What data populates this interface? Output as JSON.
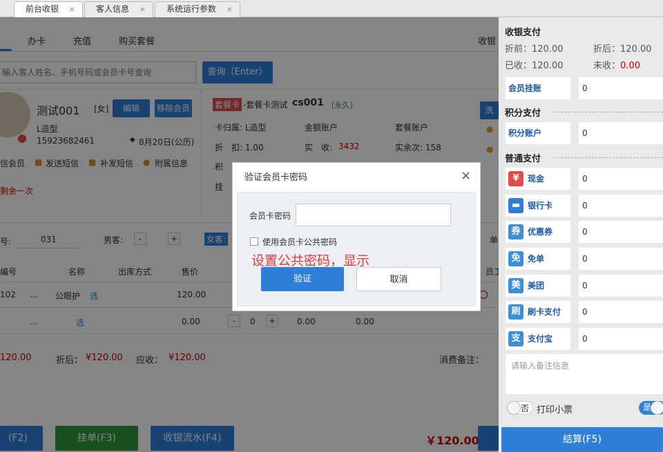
{
  "tabs": [
    {
      "label": "前台收银"
    },
    {
      "label": "客人信息"
    },
    {
      "label": "系统运行参数"
    }
  ],
  "close_glyph": "×",
  "main": {
    "top_nav": [
      "办卡",
      "充值",
      "购买套餐"
    ],
    "cashier_cut": "收银",
    "search": {
      "placeholder": "输入客人姓名、手机号码或会员卡号查询",
      "button": "查询（Enter）"
    },
    "member": {
      "name": "测试001",
      "gender": "[女]",
      "edit": "编辑",
      "remove": "移除会员",
      "type": "L造型",
      "phone": "15923682461",
      "birthday": "8月20日(公历)"
    },
    "member_actions": [
      "信会员",
      "发送短信",
      "补发短信",
      "附属信息"
    ],
    "remaining": "剩余一次",
    "card": {
      "badge": "套餐卡",
      "title": "-套餐卡测试",
      "code": "cs001",
      "permanent": "[永久]",
      "belong": "卡归属: L造型",
      "amount_acct": "金额账户",
      "package_acct": "套餐账户",
      "discount": "折　扣: 1.00",
      "received_label": "实　收:",
      "received": "3432",
      "remaining_count": "实余次: 158",
      "ji": "积",
      "gua": "挂",
      "wash": "洗"
    },
    "order": {
      "no_label": "号:",
      "no": "031",
      "male": "男客:",
      "female": "女客:",
      "minus": "-",
      "plus": "+",
      "dan": "单"
    },
    "table": {
      "headers": [
        "编号",
        "名称",
        "出库方式",
        "售价",
        "员工"
      ],
      "rows": [
        {
          "code": "102",
          "dots": "…",
          "name": "公眼护",
          "select": "选",
          "price": "120.00",
          "qty": ""
        },
        {
          "code": "",
          "dots": "…",
          "name": "",
          "select": "选",
          "price": "0.00",
          "qty": "0",
          "amount": "0.00",
          "amount2": "0.00"
        }
      ]
    },
    "totals": {
      "left": "120.00",
      "after_label": "折后：",
      "after": "¥120.00",
      "due_label": "应收：",
      "due": "¥120.00",
      "remark_label": "消费备注："
    },
    "bottom": {
      "b1": "(F2)",
      "b2": "挂单(F3)",
      "b3": "收银流水(F4)",
      "total": "￥120.00"
    }
  },
  "right": {
    "title": "收银支付",
    "before_label": "折前：",
    "before": "120.00",
    "after_label": "折后：",
    "after": "120.00",
    "received_label": "已收：",
    "received": "120.00",
    "unreceived_label": "未收：",
    "unreceived": "0.00",
    "member_credit": {
      "label": "会员挂账",
      "value": "0"
    },
    "points_section": "积分支付",
    "points": {
      "label": "积分账户",
      "value": "0"
    },
    "normal_section": "普通支付",
    "methods": [
      {
        "name": "现金",
        "icon": "¥",
        "color": "#e34b4b",
        "value": "0",
        "icon_name": "cash-icon"
      },
      {
        "name": "银行卡",
        "icon": "▬",
        "color": "#2f7fd8",
        "value": "0",
        "icon_name": "bank-card-icon"
      },
      {
        "name": "优惠券",
        "icon": "券",
        "color": "#3b8fd9",
        "value": "0",
        "icon_name": "coupon-icon"
      },
      {
        "name": "免单",
        "icon": "免",
        "color": "#3b8fd9",
        "value": "0",
        "icon_name": "free-order-icon"
      },
      {
        "name": "美团",
        "icon": "美",
        "color": "#3b8fd9",
        "value": "0",
        "icon_name": "meituan-icon"
      },
      {
        "name": "刷卡支付",
        "icon": "刷",
        "color": "#3b8fd9",
        "value": "0",
        "icon_name": "swipe-card-icon"
      },
      {
        "name": "支付宝",
        "icon": "支",
        "color": "#3b8fd9",
        "value": "0",
        "icon_name": "alipay-icon"
      }
    ],
    "remark_placeholder": "请输入备注信息",
    "toggle_no": "否",
    "print_receipt": "打印小票",
    "toggle_yes": "是",
    "settle": "结算(F5)"
  },
  "dialog": {
    "title": "验证会员卡密码",
    "password_label": "会员卡密码",
    "checkbox_label": "使用会员卡公共密码",
    "annotation": "设置公共密码，显示",
    "verify": "验证",
    "cancel": "取消"
  },
  "colors": {
    "accent": "#2f7fd8",
    "danger": "#cc0000",
    "green": "#2e9a3e"
  }
}
